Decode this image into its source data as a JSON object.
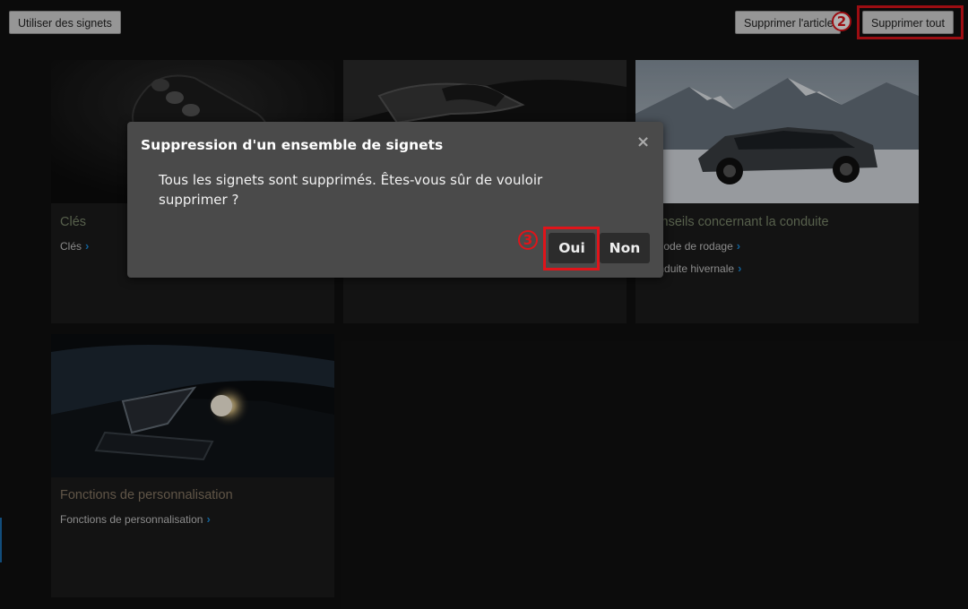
{
  "toolbar": {
    "use_bookmarks": "Utiliser des signets",
    "delete_article": "Supprimer l'article",
    "delete_all": "Supprimer tout"
  },
  "markers": {
    "step2": "2",
    "step3": "3"
  },
  "cards": [
    {
      "title": "Clés",
      "links": [
        "Clés"
      ]
    },
    {
      "title": "",
      "links": []
    },
    {
      "title": "Conseils concernant la conduite",
      "links": [
        "Période de rodage",
        "Conduite hivernale"
      ]
    },
    {
      "title": "Fonctions de personnalisation",
      "links": [
        "Fonctions de personnalisation"
      ]
    }
  ],
  "dialog": {
    "title": "Suppression d'un ensemble de signets",
    "message": "Tous les signets sont supprimés. Êtes-vous sûr de vouloir supprimer ?",
    "yes": "Oui",
    "no": "Non",
    "close": "×"
  },
  "colors": {
    "accent_link": "#1a8ad8",
    "highlight_red": "#e0141a"
  }
}
